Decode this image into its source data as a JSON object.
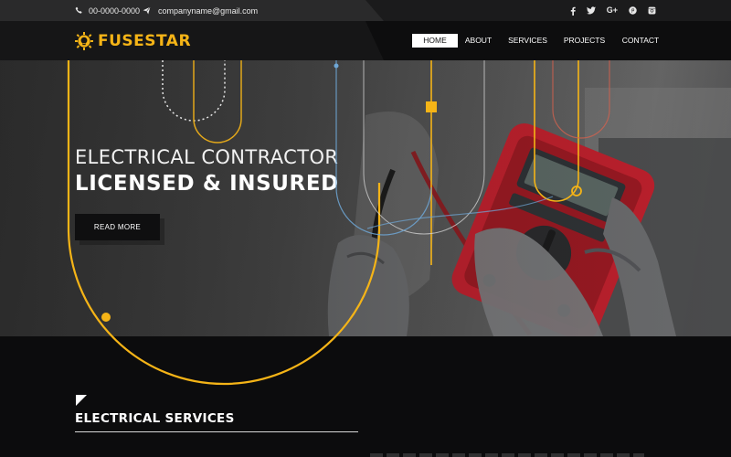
{
  "topbar": {
    "phone": "00-0000-0000",
    "email": "companyname@gmail.com",
    "socials": [
      {
        "icon": "facebook-icon",
        "glyph": "f"
      },
      {
        "icon": "twitter-icon",
        "glyph": "t"
      },
      {
        "icon": "google-plus-icon",
        "glyph": "G+"
      },
      {
        "icon": "pinterest-icon",
        "glyph": "p"
      },
      {
        "icon": "instagram-icon",
        "glyph": "ig"
      }
    ]
  },
  "header": {
    "logo_text": "FUSESTAR",
    "nav": [
      "HOME",
      "ABOUT",
      "SERVICES",
      "PROJECTS",
      "CONTACT"
    ],
    "active_nav": "HOME"
  },
  "hero": {
    "line1": "ELECTRICAL CONTRACTOR",
    "line2": "LICENSED & INSURED",
    "button": "READ MORE"
  },
  "services": {
    "title": "ELECTRICAL SERVICES"
  },
  "colors": {
    "accent": "#f5b417",
    "topbar": "#2a2a2b",
    "header": "#161617",
    "footer": "#0c0c0d",
    "wire_blue": "#6fa7d6",
    "wire_red": "#d0614f",
    "meter_red": "#c4202d"
  }
}
